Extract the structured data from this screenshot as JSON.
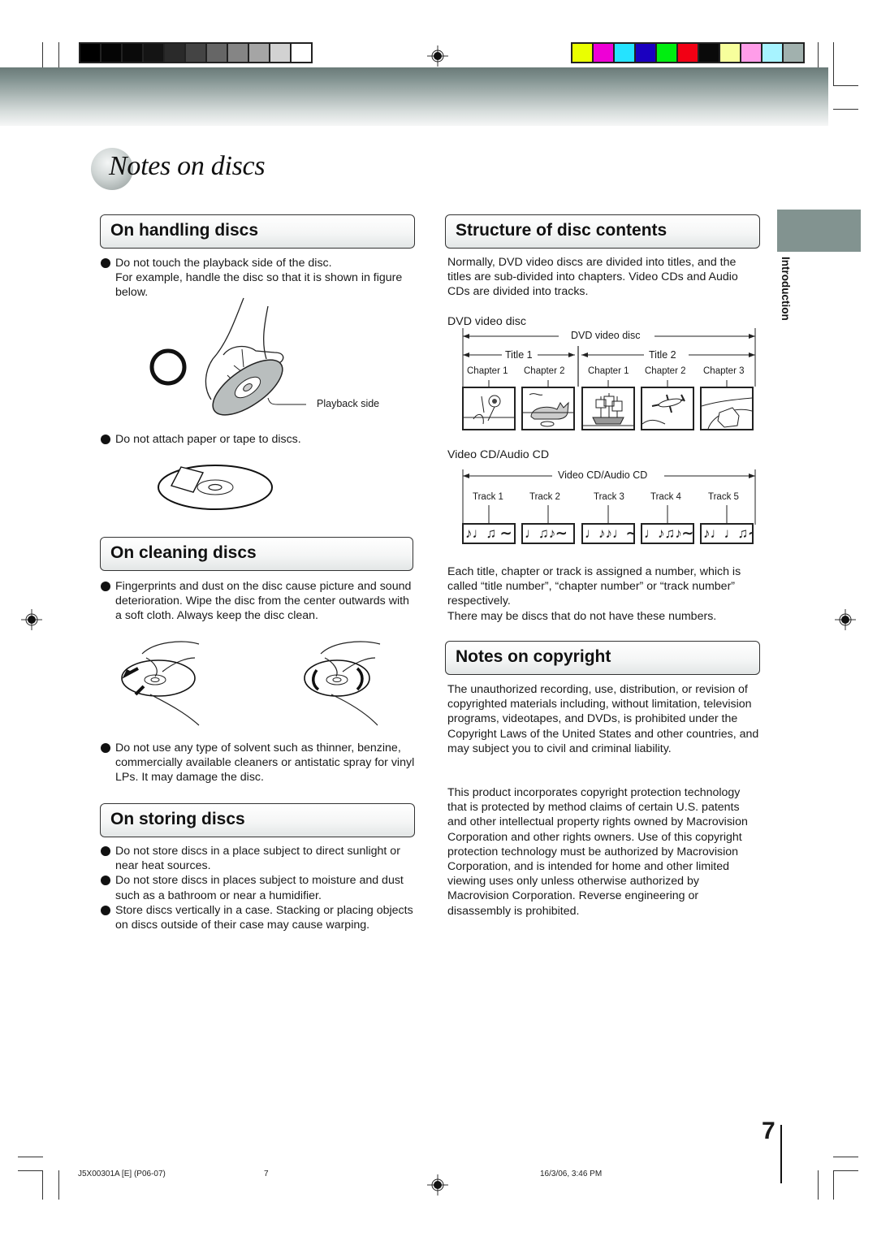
{
  "page": {
    "title": "Notes on discs",
    "side_tab_label": "Introduction",
    "page_number": "7",
    "accent_color": "#829390"
  },
  "print_marks": {
    "gray_swatches": [
      "#000000",
      "#050505",
      "#0a0a0a",
      "#141414",
      "#2a2a2a",
      "#444444",
      "#666666",
      "#858585",
      "#a5a5a5",
      "#d2d2d2",
      "#ffffff"
    ],
    "color_swatches": [
      "#eaff00",
      "#ee00d6",
      "#25e3ff",
      "#1a00c0",
      "#00ee10",
      "#f20014",
      "#0a0a0a",
      "#f7ff9c",
      "#ff9de9",
      "#a7f3ff",
      "#a1b1ae"
    ]
  },
  "handling": {
    "heading": "On handling discs",
    "bullet1_line1": "Do not touch the playback side of the disc.",
    "bullet1_line2": "For example, handle the disc so that it is shown in figure below.",
    "figure_label": "Playback side",
    "bullet2": "Do not attach paper or tape to discs."
  },
  "cleaning": {
    "heading": "On cleaning discs",
    "bullet1": "Fingerprints and dust on the disc cause picture and sound deterioration. Wipe the disc from the center outwards with a soft cloth. Always keep the disc clean.",
    "bullet2": "Do not use any type of solvent such as thinner, benzine, commercially available cleaners or antistatic spray for vinyl LPs. It may damage the disc."
  },
  "storing": {
    "heading": "On storing discs",
    "bullets": [
      "Do not store discs in a place subject to direct sunlight or near heat sources.",
      "Do not store discs in places subject to moisture and dust such as a bathroom or near a humidifier.",
      "Store discs vertically in a case. Stacking or placing objects on discs outside of their case may cause warping."
    ]
  },
  "structure": {
    "heading": "Structure of disc contents",
    "intro": "Normally, DVD video discs are divided into titles, and the titles are sub-divided into chapters. Video CDs and Audio CDs are divided into tracks.",
    "dvd_caption": "DVD video disc",
    "dvd_diagram": {
      "span_label": "DVD video disc",
      "titles": [
        "Title 1",
        "Title 2"
      ],
      "chapters": [
        "Chapter 1",
        "Chapter 2",
        "Chapter 1",
        "Chapter 2",
        "Chapter 3"
      ],
      "thumbnails": [
        "flowers",
        "cat",
        "ship",
        "airplane",
        "car"
      ]
    },
    "cd_caption": "Video CD/Audio CD",
    "cd_diagram": {
      "span_label": "Video CD/Audio CD",
      "tracks": [
        "Track 1",
        "Track 2",
        "Track 3",
        "Track 4",
        "Track 5"
      ],
      "notes": [
        "♪♩♫ ∼",
        "♩♫♪∼",
        "♩♪♪♩∼",
        "♩♪♫♪∼",
        "♪♩♩♫∼"
      ]
    },
    "numbering_text": "Each title, chapter or track is assigned a number, which is called “title number”, “chapter number” or “track number” respectively.",
    "numbering_note": "There may be discs that do not have these numbers."
  },
  "copyright": {
    "heading": "Notes on copyright",
    "para1": "The unauthorized recording, use, distribution, or revision of copyrighted materials including, without limitation, television programs, videotapes, and DVDs, is prohibited under the Copyright Laws of the United States and other countries, and may subject you to civil and criminal liability.",
    "para2": "This product incorporates copyright protection technology that is protected by method claims of certain U.S. patents and other intellectual property rights owned by Macrovision Corporation and other rights owners. Use of this copyright protection technology must be authorized by Macrovision Corporation, and is intended for home and other limited viewing uses only unless otherwise authorized by Macrovision Corporation. Reverse engineering or disassembly is prohibited."
  },
  "footer": {
    "file_code": "J5X00301A [E] (P06-07)",
    "sheet_number": "7",
    "timestamp": "16/3/06, 3:46 PM"
  }
}
